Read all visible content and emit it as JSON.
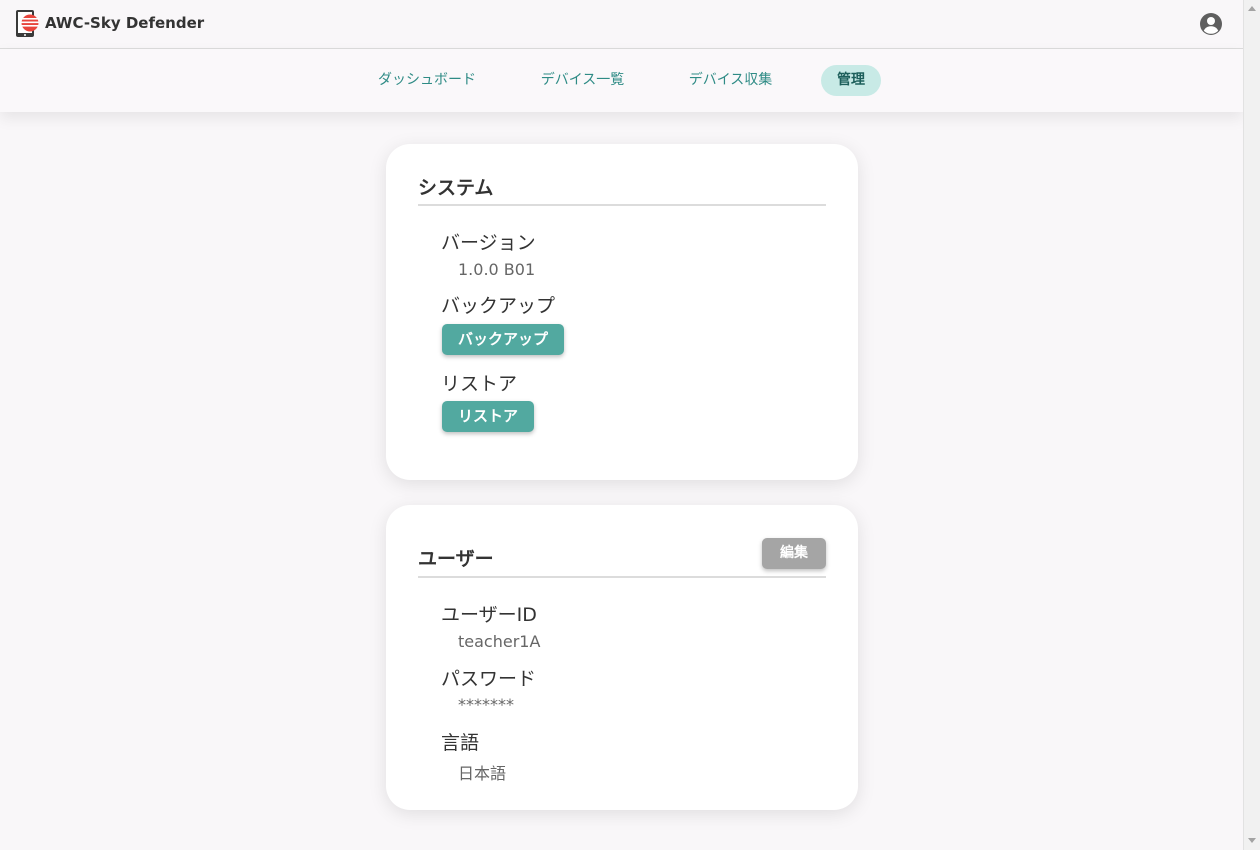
{
  "header": {
    "app_title": "AWC-Sky Defender"
  },
  "nav": {
    "items": [
      {
        "label": "ダッシュボード",
        "active": false
      },
      {
        "label": "デバイス一覧",
        "active": false
      },
      {
        "label": "デバイス収集",
        "active": false
      },
      {
        "label": "管理",
        "active": true
      }
    ]
  },
  "system_card": {
    "title": "システム",
    "version_label": "バージョン",
    "version_value": "1.0.0 B01",
    "backup_label": "バックアップ",
    "backup_button": "バックアップ",
    "restore_label": "リストア",
    "restore_button": "リストア"
  },
  "user_card": {
    "title": "ユーザー",
    "edit_button": "編集",
    "user_id_label": "ユーザーID",
    "user_id_value": "teacher1A",
    "password_label": "パスワード",
    "password_value": "*******",
    "language_label": "言語",
    "language_value": "日本語"
  },
  "colors": {
    "accent": "#52a9a0",
    "nav_text": "#2e8b85",
    "nav_active_bg": "#c8eae6",
    "edit_button": "#a5a5a5"
  },
  "icons": {
    "logo": "awc-logo-icon",
    "account": "account-circle-icon"
  }
}
